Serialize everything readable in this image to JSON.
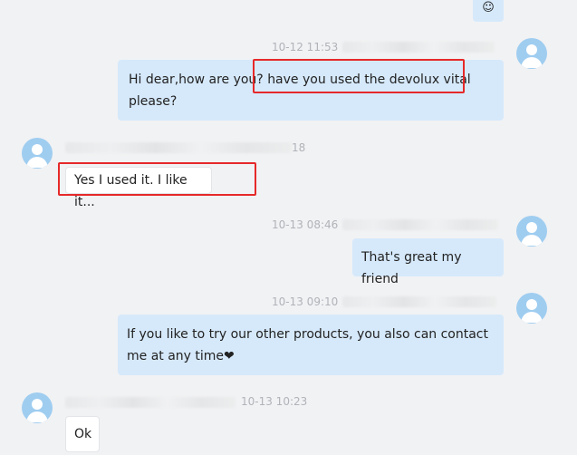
{
  "messages": [
    {
      "id": "m0",
      "side": "right",
      "text": "☺"
    },
    {
      "id": "m1",
      "side": "right",
      "timestamp": "10-12 11:53",
      "text_a": "Hi dear,how are you? ",
      "text_b": "have you used the devolux vital",
      "text_c": "please?"
    },
    {
      "id": "m2",
      "side": "left",
      "timestamp_partial": "18",
      "text": "Yes I used it. I like it..."
    },
    {
      "id": "m3",
      "side": "right",
      "timestamp": "10-13 08:46",
      "text": "That's great my friend"
    },
    {
      "id": "m4",
      "side": "right",
      "timestamp": "10-13 09:10",
      "text_a": "If you like to try our other products, you also can contact",
      "text_b": "me at any time",
      "heart": "❤"
    },
    {
      "id": "m5",
      "side": "left",
      "timestamp": "10-13 10:23",
      "text": "Ok"
    }
  ],
  "colors": {
    "outgoing_bubble": "#d6e9fb",
    "incoming_bubble": "#ffffff",
    "avatar": "#9fcdf0",
    "highlight": "#e62929"
  }
}
